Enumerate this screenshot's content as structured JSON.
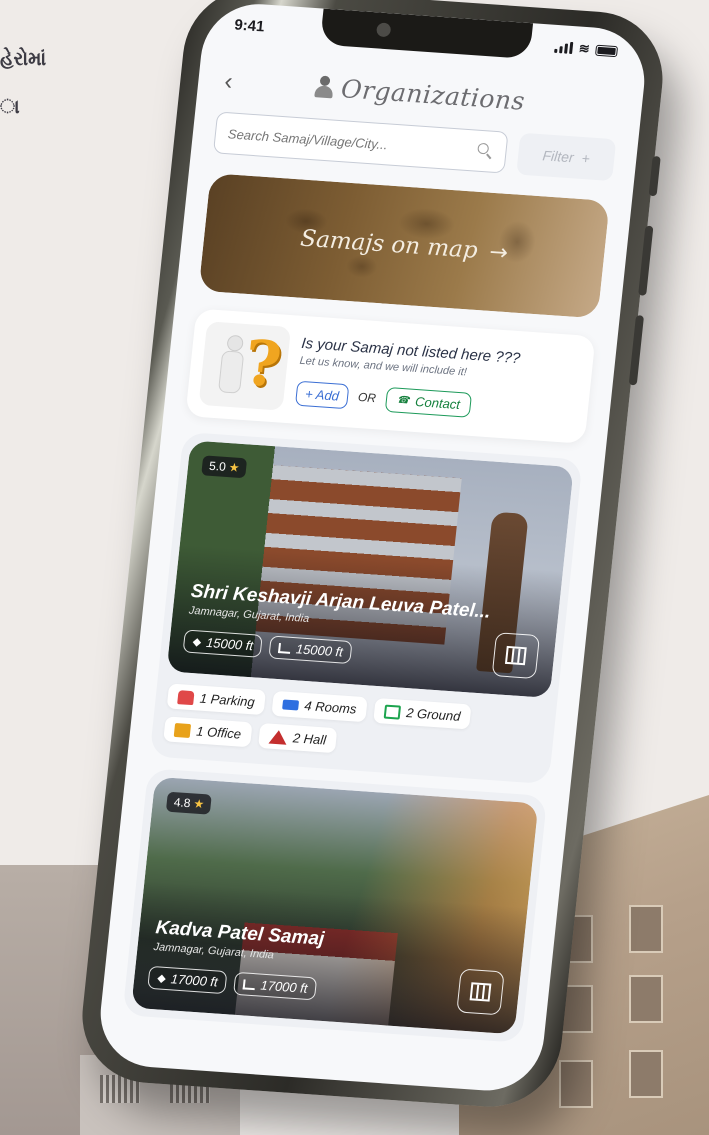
{
  "background": {
    "line1": "હેરોમાં",
    "line2": "ા"
  },
  "status_bar": {
    "time": "9:41"
  },
  "header": {
    "title": "Organizations",
    "back_icon": "chevron-left-icon"
  },
  "search": {
    "placeholder": "Search Samaj/Village/City...",
    "value": ""
  },
  "filter": {
    "label": "Filter",
    "icon": "+"
  },
  "map_banner": {
    "label": "Samajs on map",
    "arrow": "→"
  },
  "not_listed": {
    "title": "Is your Samaj not listed here ???",
    "subtitle": "Let us know, and we will include it!",
    "add_label": "+ Add",
    "or_label": "OR",
    "contact_label": "Contact"
  },
  "listings": [
    {
      "rating": "5.0",
      "name": "Shri Keshavji Arjan Leuva Patel...",
      "location": "Jamnagar, Gujarat, India",
      "built_area": "15000 ft",
      "plot_area": "15000 ft",
      "amenities": [
        {
          "icon": "car-icon",
          "label": "1 Parking"
        },
        {
          "icon": "bed-icon",
          "label": "4 Rooms"
        },
        {
          "icon": "ground-icon",
          "label": "2 Ground"
        },
        {
          "icon": "office-icon",
          "label": "1 Office"
        },
        {
          "icon": "hall-icon",
          "label": "2 Hall"
        }
      ]
    },
    {
      "rating": "4.8",
      "name": "Kadva Patel Samaj",
      "location": "Jamnagar, Gujarat, India",
      "built_area": "17000 ft",
      "plot_area": "17000 ft"
    }
  ],
  "colors": {
    "accent_blue": "#3b6fd4",
    "accent_green": "#15803d",
    "star": "#f6c343"
  }
}
